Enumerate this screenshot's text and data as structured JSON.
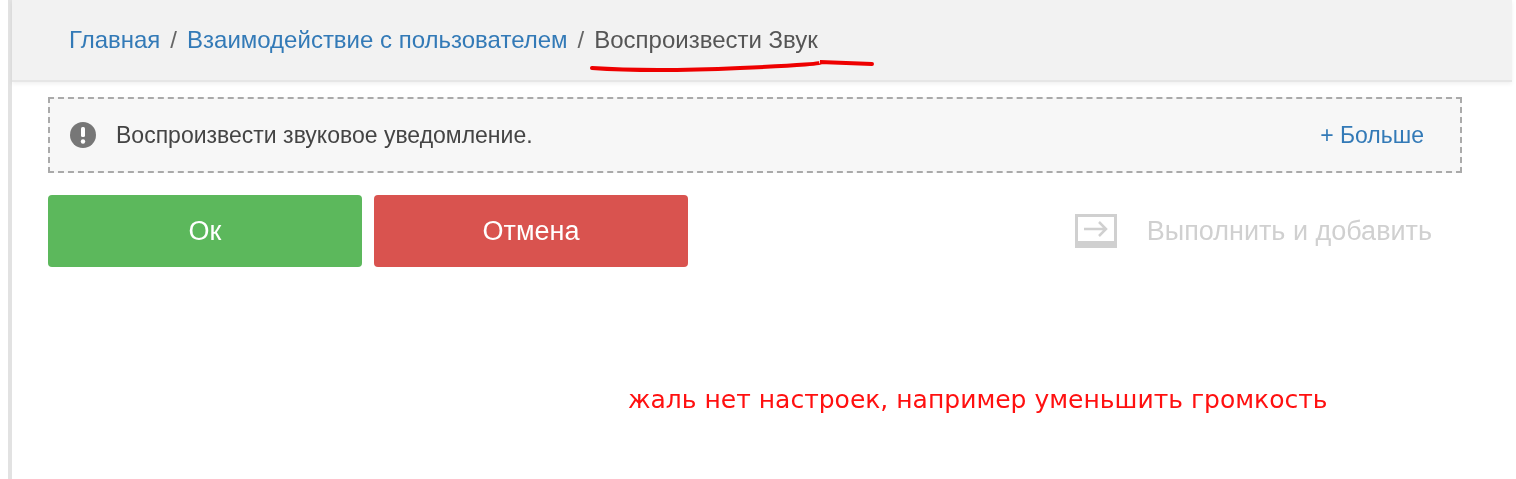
{
  "breadcrumb": [
    {
      "label": "Главная",
      "current": false
    },
    {
      "label": "Взаимодействие с пользователем",
      "current": false
    },
    {
      "label": "Воспроизвести Звук",
      "current": true
    }
  ],
  "breadcrumb_separator": "/",
  "notice": {
    "text": "Воспроизвести звуковое уведомление.",
    "more_link": "+ Больше"
  },
  "buttons": [
    {
      "label": "Ок",
      "kind": "ok"
    },
    {
      "label": "Отмена",
      "kind": "cancel"
    }
  ],
  "secondary_action": {
    "label": "Выполнить и добавить",
    "disabled": true
  },
  "annotation": "жаль нет настроек, например уменьшить громкость"
}
